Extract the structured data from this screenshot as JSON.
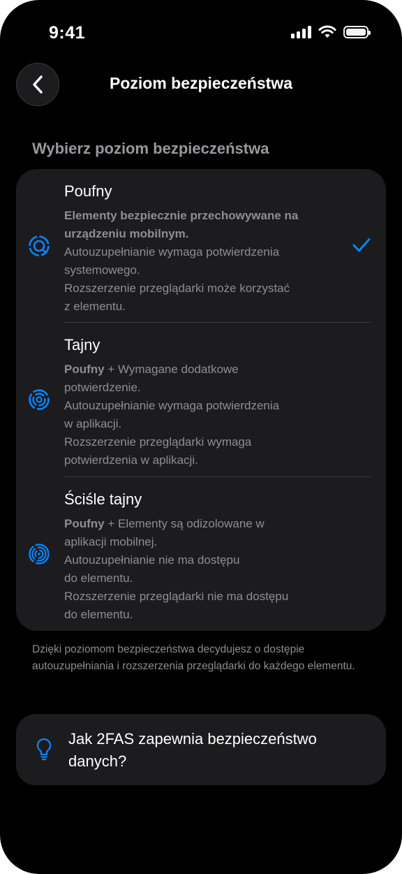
{
  "status_bar": {
    "time": "9:41"
  },
  "header": {
    "title": "Poziom bezpieczeństwa"
  },
  "section_title": "Wybierz poziom bezpieczeństwa",
  "options": [
    {
      "name": "Poufny",
      "selected": true,
      "lines": [
        {
          "bold": "Elementy bezpiecznie przechowywane na",
          "text": ""
        },
        {
          "bold": "urządzeniu mobilnym.",
          "text": ""
        },
        {
          "bold": "",
          "text": "Autouzupełnianie wymaga potwierdzenia"
        },
        {
          "bold": "",
          "text": "systemowego."
        },
        {
          "bold": "",
          "text": "Rozszerzenie przeglądarki może korzystać"
        },
        {
          "bold": "",
          "text": "z elementu."
        }
      ]
    },
    {
      "name": "Tajny",
      "selected": false,
      "lines": [
        {
          "bold": "Poufny",
          "text": " + Wymagane dodatkowe"
        },
        {
          "bold": "",
          "text": "potwierdzenie."
        },
        {
          "bold": "",
          "text": "Autouzupełnianie wymaga potwierdzenia"
        },
        {
          "bold": "",
          "text": "w aplikacji."
        },
        {
          "bold": "",
          "text": "Rozszerzenie przeglądarki wymaga"
        },
        {
          "bold": "",
          "text": "potwierdzenia w aplikacji."
        }
      ]
    },
    {
      "name": "Ściśle tajny",
      "selected": false,
      "lines": [
        {
          "bold": "Poufny",
          "text": " + Elementy są odizolowane w"
        },
        {
          "bold": "",
          "text": "aplikacji mobilnej."
        },
        {
          "bold": "",
          "text": "Autouzupełnianie nie ma dostępu"
        },
        {
          "bold": "",
          "text": "do elementu."
        },
        {
          "bold": "",
          "text": "Rozszerzenie przeglądarki nie ma dostępu"
        },
        {
          "bold": "",
          "text": "do elementu."
        }
      ]
    }
  ],
  "footnote": "Dzięki poziomom bezpieczeństwa decydujesz o dostępie autouzupełniania i rozszerzenia przeglądarki do każdego elementu.",
  "info_card": {
    "text": "Jak 2FAS zapewnia bezpieczeństwo danych?",
    "icon": "lightbulb-icon"
  },
  "colors": {
    "accent": "#0a84ff",
    "background": "#000000",
    "card": "#1c1c1e",
    "secondary_text": "#8e8e93"
  }
}
